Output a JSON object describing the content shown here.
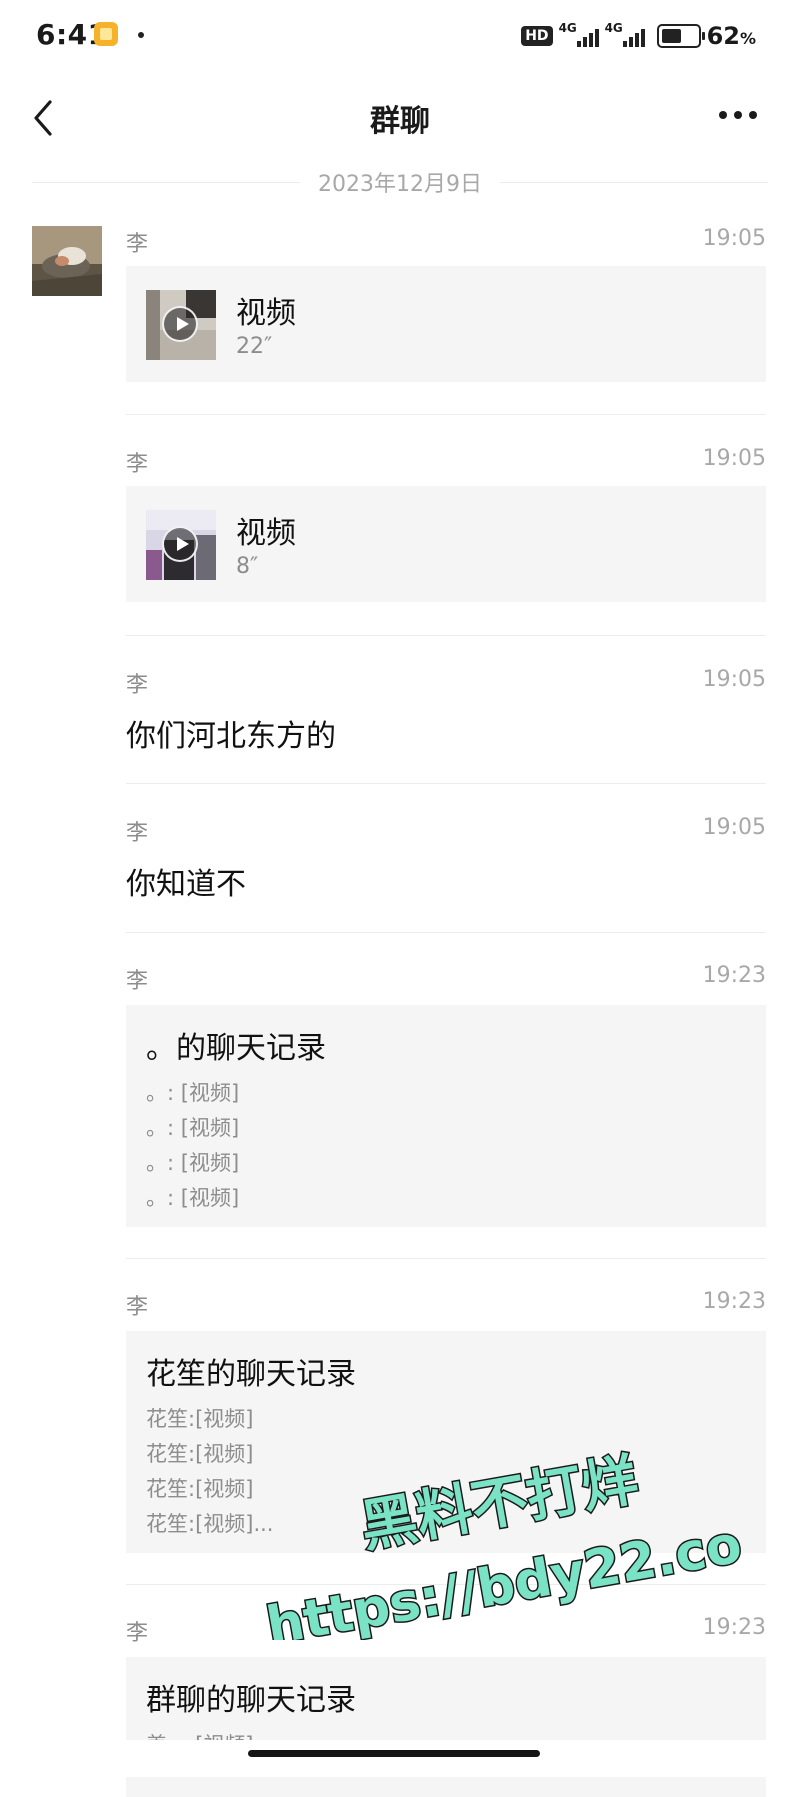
{
  "status_bar": {
    "time": "6:41",
    "hd_label": "HD",
    "network_1": "4G",
    "network_2": "4G",
    "battery_percent": "62",
    "battery_unit": "%",
    "battery_level": 0.62
  },
  "header": {
    "title": "群聊"
  },
  "date_separator": "2023年12月9日",
  "messages": [
    {
      "sender": "李",
      "time": "19:05",
      "type": "video",
      "title": "视频",
      "duration": "22″"
    },
    {
      "sender": "李",
      "time": "19:05",
      "type": "video",
      "title": "视频",
      "duration": "8″"
    },
    {
      "sender": "李",
      "time": "19:05",
      "type": "text",
      "text": "你们河北东方的"
    },
    {
      "sender": "李",
      "time": "19:05",
      "type": "text",
      "text": "你知道不"
    },
    {
      "sender": "李",
      "time": "19:23",
      "type": "record",
      "title": "。的聊天记录",
      "lines": [
        "。: [视频]",
        "。: [视频]",
        "。: [视频]",
        "。: [视频]"
      ]
    },
    {
      "sender": "李",
      "time": "19:23",
      "type": "record",
      "title": "花笙的聊天记录",
      "lines": [
        "花笙:[视频]",
        "花笙:[视频]",
        "花笙:[视频]",
        "花笙:[视频]..."
      ]
    },
    {
      "sender": "李",
      "time": "19:23",
      "type": "record",
      "title": "群聊的聊天记录",
      "lines": [
        "姜一:[视频]"
      ]
    }
  ],
  "watermark": {
    "line1": "黑料不打烊",
    "line2": "https://bdy22.co",
    "color": "#7be3c5"
  },
  "colors": {
    "bubble_bg": "#f5f5f5",
    "meta_text": "#a8a8a8"
  }
}
